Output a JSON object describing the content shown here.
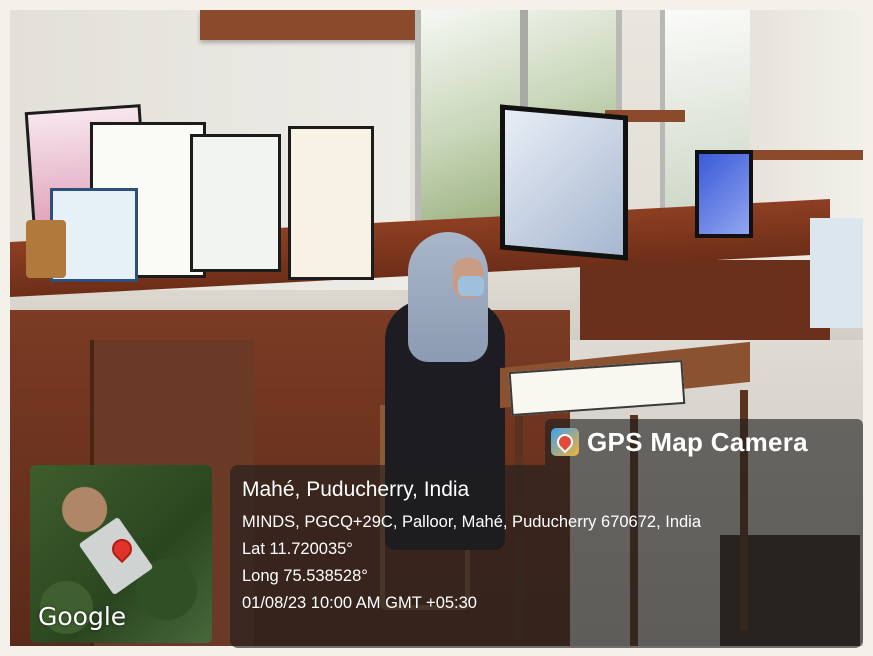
{
  "overlay": {
    "brand": "GPS Map Camera",
    "location_title": "Mahé, Puducherry, India",
    "address": "MINDS, PGCQ+29C, Palloor, Mahé, Puducherry 670672, India",
    "latitude": "Lat 11.720035°",
    "longitude": "Long 75.538528°",
    "datetime": "01/08/23 10:00 AM GMT +05:30",
    "map_logo": "Google"
  },
  "colors": {
    "overlay_bg": "#1e1e1e",
    "map_pin": "#e0332a"
  }
}
